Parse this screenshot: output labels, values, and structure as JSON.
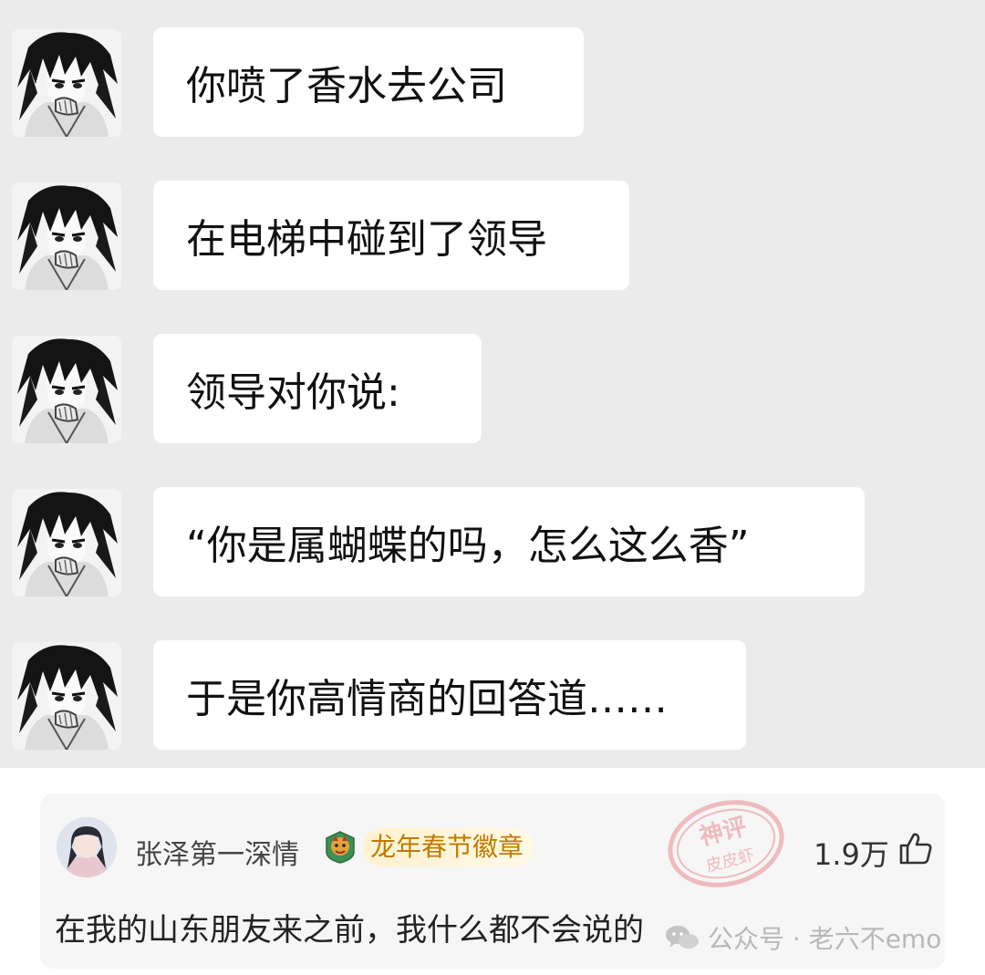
{
  "chat": {
    "messages": [
      {
        "text": "你喷了香水去公司"
      },
      {
        "text": "在电梯中碰到了领导"
      },
      {
        "text": "领导对你说:"
      },
      {
        "text": "“你是属蝴蝶的吗，怎么这么香”"
      },
      {
        "text": "于是你高情商的回答道……"
      }
    ]
  },
  "comment": {
    "username": "张泽第一深情",
    "badge": "龙年春节徽章",
    "likes": "1.9万",
    "text": "在我的山东朋友来之前，我什么都不会说的"
  },
  "stamp": {
    "line1": "神评",
    "line2": "皮皮虾"
  },
  "watermark": {
    "label": "公众号 · 老六不emo"
  },
  "colors": {
    "chat_bg": "#ebebeb",
    "bubble": "#ffffff",
    "badge_text": "#c07a00",
    "stamp": "#e0505a"
  }
}
